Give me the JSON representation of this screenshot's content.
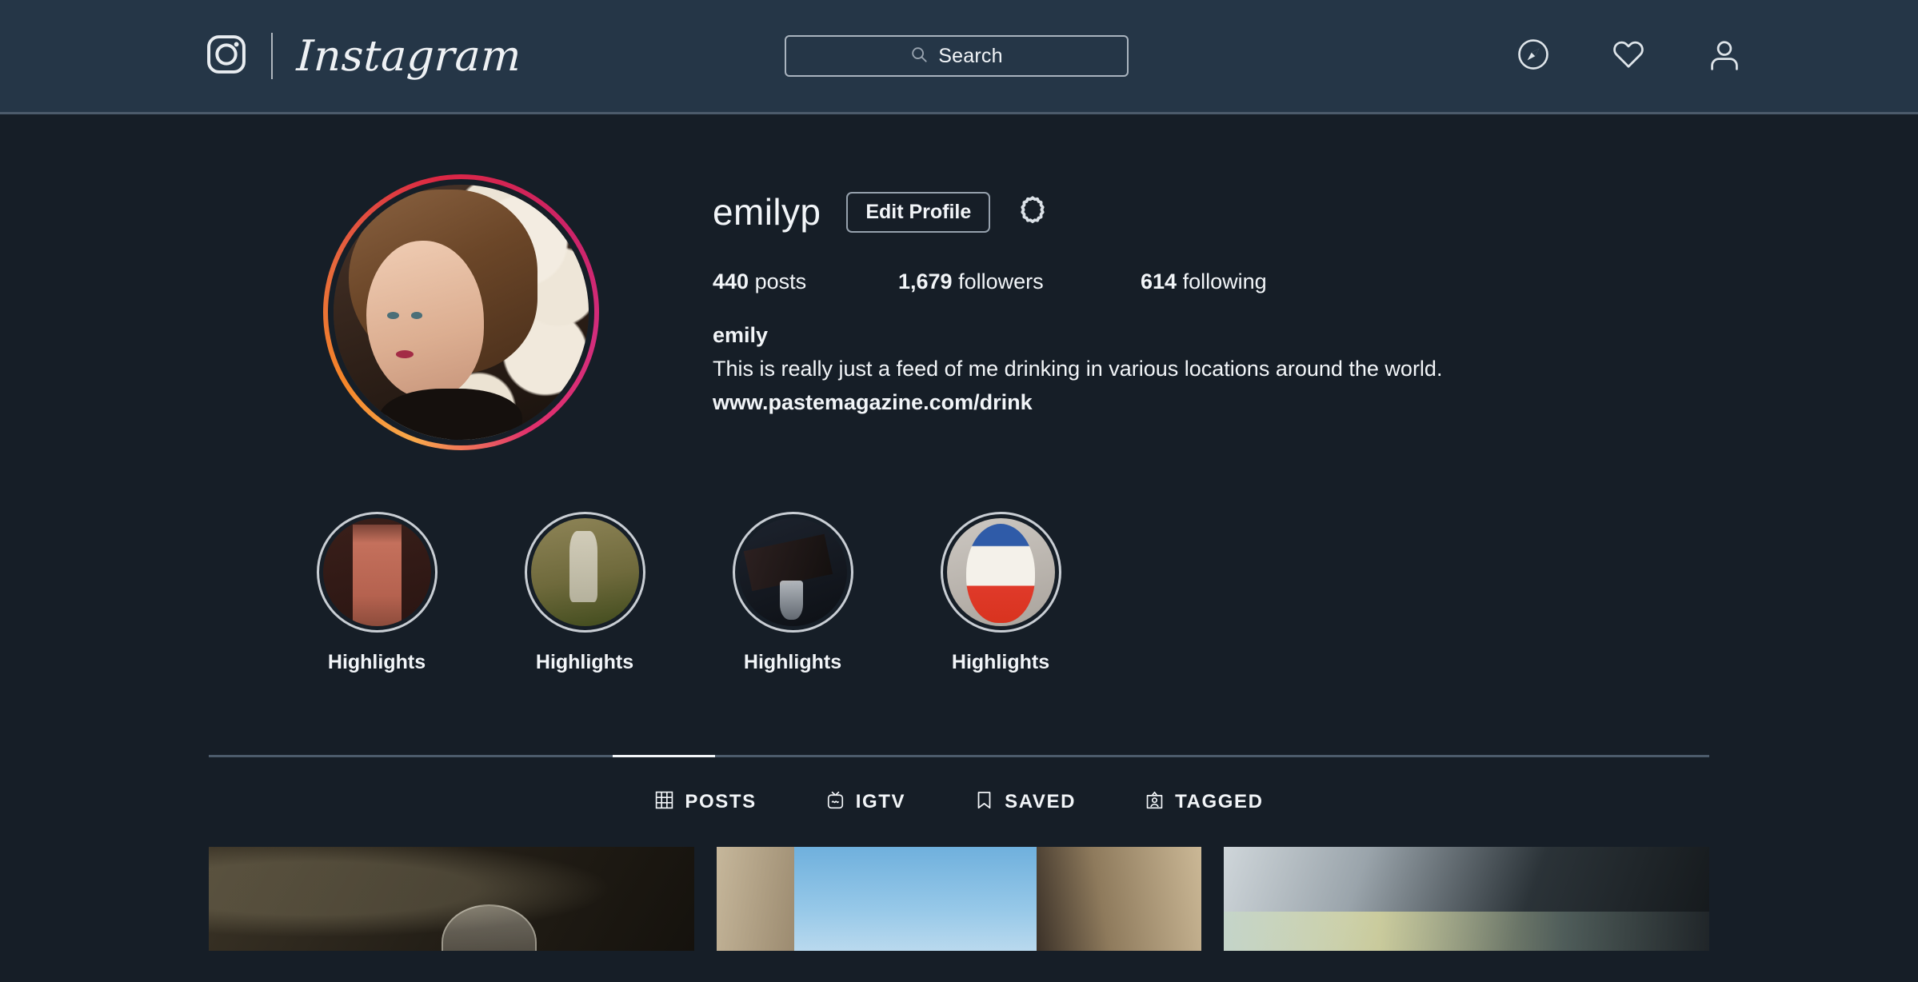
{
  "header": {
    "brand_name": "Instagram",
    "logo_icon": "instagram-camera-icon",
    "search": {
      "placeholder": "Search",
      "value": "",
      "icon": "search-icon"
    },
    "icons": [
      {
        "name": "explore-compass-icon",
        "label": "Explore"
      },
      {
        "name": "activity-heart-icon",
        "label": "Activity"
      },
      {
        "name": "profile-person-icon",
        "label": "Profile"
      }
    ]
  },
  "profile": {
    "username": "emilyp",
    "edit_button_label": "Edit Profile",
    "settings_icon": "gear-icon",
    "avatar_alt": "profile-photo",
    "has_story_ring": true,
    "stats": [
      {
        "key": "posts",
        "count": "440",
        "label": "posts"
      },
      {
        "key": "followers",
        "count": "1,679",
        "label": "followers"
      },
      {
        "key": "following",
        "count": "614",
        "label": "following"
      }
    ],
    "full_name": "emily",
    "bio": "This is really just a feed of me drinking in various locations around the world.",
    "website": "www.pastemagazine.com/drink"
  },
  "highlights": [
    {
      "label": "Highlights",
      "thumb": "cocktail-pink-drink"
    },
    {
      "label": "Highlights",
      "thumb": "bottle-green-background"
    },
    {
      "label": "Highlights",
      "thumb": "pouring-dark-drink"
    },
    {
      "label": "Highlights",
      "thumb": "kinder-surprise-egg"
    }
  ],
  "tabs": [
    {
      "label": "POSTS",
      "icon": "grid-icon",
      "active": true
    },
    {
      "label": "IGTV",
      "icon": "igtv-icon",
      "active": false
    },
    {
      "label": "SAVED",
      "icon": "bookmark-icon",
      "active": false
    },
    {
      "label": "TAGGED",
      "icon": "tagged-person-icon",
      "active": false
    }
  ],
  "posts": [
    {
      "alt": "dark-scene-with-glass"
    },
    {
      "alt": "blue-sky-between-buildings"
    },
    {
      "alt": "vehicle-window-reflection"
    }
  ],
  "colors": {
    "header_bg": "#253647",
    "page_bg": "#161e27",
    "text": "#f2f5f8",
    "border": "#4c5b6b",
    "story_ring_start": "#f9a94b",
    "story_ring_end": "#cc2366"
  }
}
